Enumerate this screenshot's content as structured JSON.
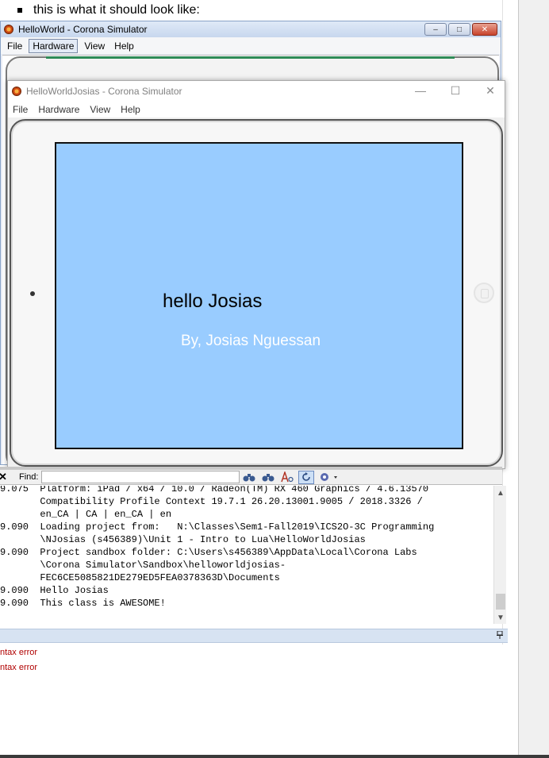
{
  "doc": {
    "bullet_text": "this is what it should look like:"
  },
  "back_window": {
    "title": "HelloWorld - Corona Simulator",
    "menu": [
      "File",
      "Hardware",
      "View",
      "Help"
    ],
    "controls": {
      "minimize": "–",
      "maximize": "□",
      "close": "✕"
    }
  },
  "front_window": {
    "title": "HelloWorldJosias - Corona Simulator",
    "menu": [
      "File",
      "Hardware",
      "View",
      "Help"
    ],
    "controls": {
      "minimize": "—",
      "maximize": "☐",
      "close": "✕"
    },
    "screen": {
      "background": "#99ccff",
      "hello_text": "hello Josias",
      "byline_text": "By, Josias Nguessan"
    }
  },
  "find_bar": {
    "close": "✕",
    "label": "Find:",
    "value": ""
  },
  "console": {
    "lines": [
      "9.075  Platform: iPad / x64 / 10.0 / Radeon(TM) RX 460 Graphics / 4.6.13570",
      "       Compatibility Profile Context 19.7.1 26.20.13001.9005 / 2018.3326 /",
      "       en_CA | CA | en_CA | en",
      "9.090  Loading project from:   N:\\Classes\\Sem1-Fall2019\\ICS2O-3C Programming",
      "       \\NJosias (s456389)\\Unit 1 - Intro to Lua\\HelloWorldJosias",
      "9.090  Project sandbox folder: C:\\Users\\s456389\\AppData\\Local\\Corona Labs",
      "       \\Corona Simulator\\Sandbox\\helloworldjosias-",
      "       FEC6CE5085821DE279ED5FEA0378363D\\Documents",
      "9.090  Hello Josias",
      "9.090  This class is AWESOME!"
    ]
  },
  "errors": {
    "lines": [
      "ntax error",
      "ntax error"
    ]
  }
}
